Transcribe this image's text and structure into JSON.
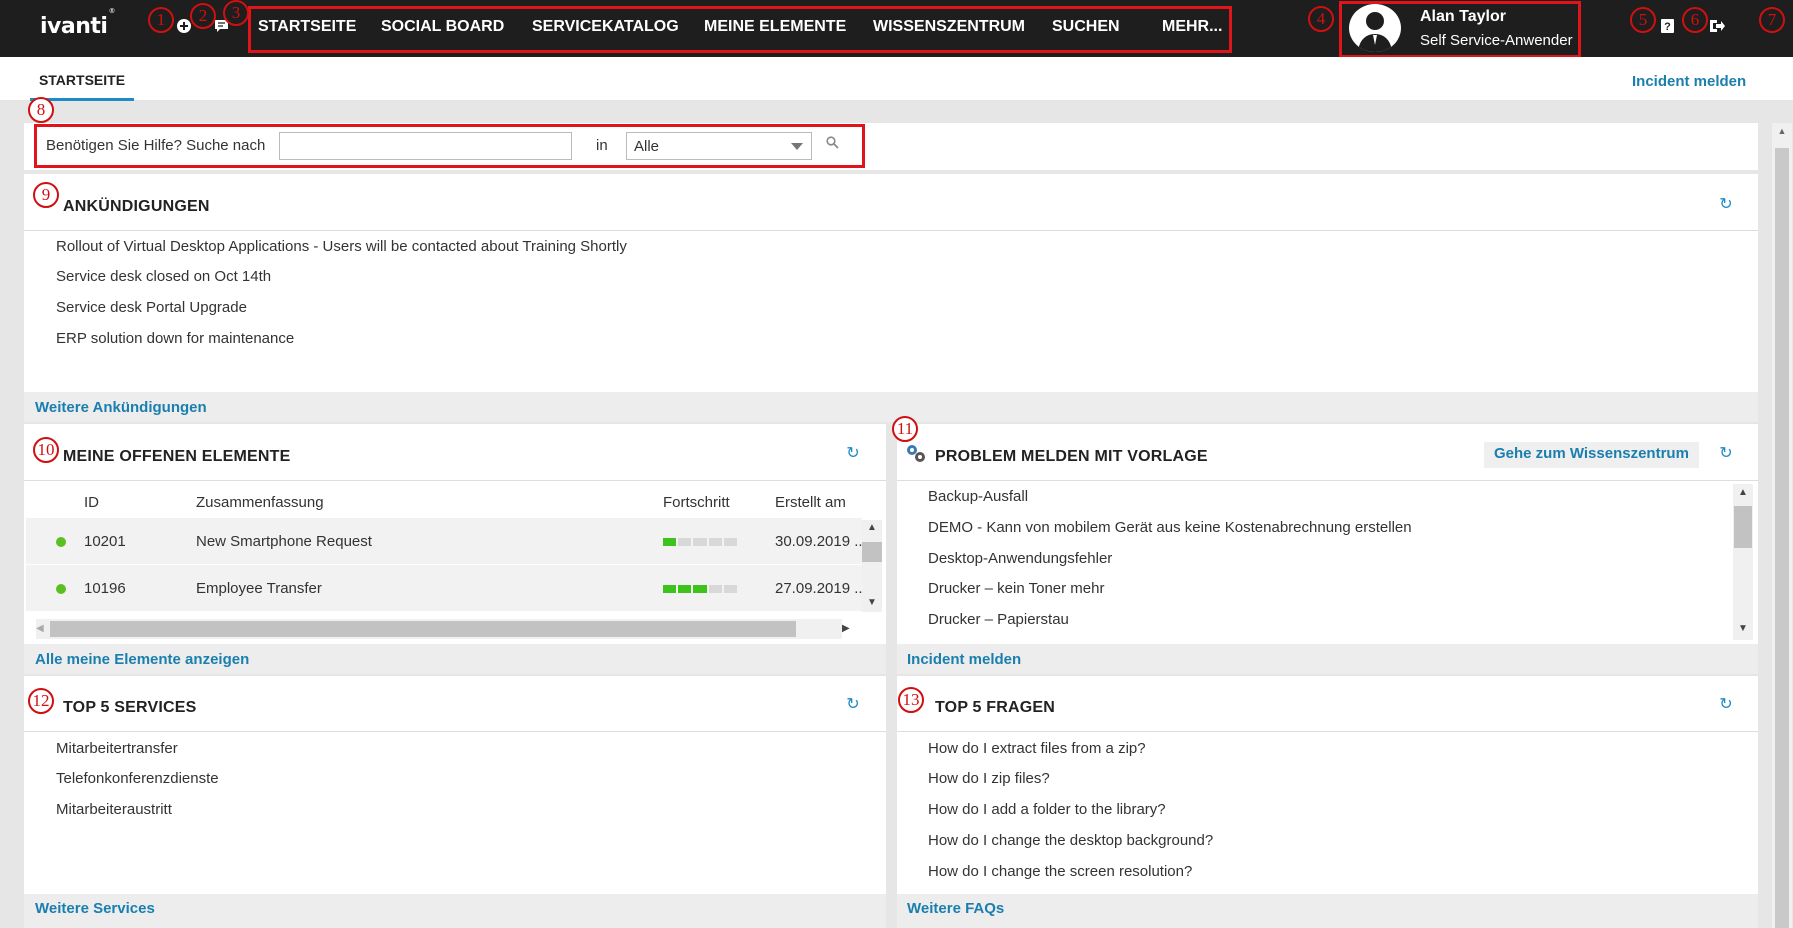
{
  "header": {
    "logo": "ivanti",
    "nav": [
      "STARTSEITE",
      "SOCIAL BOARD",
      "SERVICEKATALOG",
      "MEINE ELEMENTE",
      "WISSENSZENTRUM",
      "SUCHEN",
      "MEHR..."
    ],
    "user": {
      "name": "Alan Taylor",
      "role": "Self Service-Anwender"
    },
    "icons": [
      "add-icon",
      "chat-icon",
      "help-icon",
      "logout-icon"
    ]
  },
  "callouts": [
    "1",
    "2",
    "3",
    "4",
    "5",
    "6",
    "7",
    "8",
    "9",
    "10",
    "11",
    "12",
    "13"
  ],
  "tabs": {
    "active": "STARTSEITE",
    "incident_link": "Incident melden"
  },
  "search": {
    "label": "Benötigen Sie Hilfe? Suche nach",
    "value": "",
    "in_label": "in",
    "scope": "Alle"
  },
  "announcements": {
    "title": "ANKÜNDIGUNGEN",
    "items": [
      "Rollout of Virtual Desktop Applications - Users will be contacted about Training Shortly",
      "Service desk closed on Oct 14th",
      "Service desk Portal Upgrade",
      "ERP solution down for maintenance"
    ],
    "more": "Weitere Ankündigungen"
  },
  "open_items": {
    "title": "MEINE OFFENEN ELEMENTE",
    "columns": [
      "ID",
      "Zusammenfassung",
      "Fortschritt",
      "Erstellt am"
    ],
    "rows": [
      {
        "id": "10201",
        "summary": "New Smartphone Request",
        "progress": 0.2,
        "created": "30.09.2019 ..."
      },
      {
        "id": "10196",
        "summary": "Employee Transfer",
        "progress": 0.6,
        "created": "27.09.2019 ..."
      }
    ],
    "more": "Alle meine Elemente anzeigen"
  },
  "templates": {
    "title": "PROBLEM MELDEN MIT VORLAGE",
    "knowledge_button": "Gehe zum Wissenszentrum",
    "items": [
      "Backup-Ausfall",
      "DEMO - Kann von mobilem Gerät aus keine Kostenabrechnung erstellen",
      "Desktop-Anwendungsfehler",
      "Drucker – kein Toner mehr",
      "Drucker – Papierstau"
    ],
    "more": "Incident melden"
  },
  "top_services": {
    "title": "TOP 5 SERVICES",
    "items": [
      "Mitarbeitertransfer",
      "Telefonkonferenzdienste",
      "Mitarbeiteraustritt"
    ],
    "more": "Weitere Services"
  },
  "top_questions": {
    "title": "TOP 5 FRAGEN",
    "items": [
      "How do I extract files from a zip?",
      "How do I zip files?",
      "How do I add a folder to the library?",
      "How do I change the desktop background?",
      "How do I change the screen resolution?"
    ],
    "more": "Weitere FAQs"
  }
}
